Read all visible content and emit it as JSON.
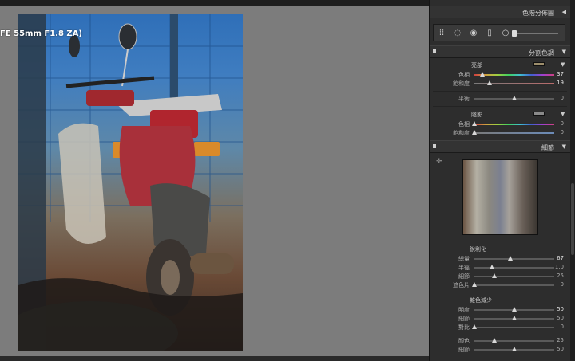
{
  "photo_overlay_text": "FE 55mm F1.8 ZA)",
  "histogram_panel": {
    "title": "色階分佈圖",
    "arrow": "◀"
  },
  "split_toning": {
    "title": "分割色調",
    "highlights": {
      "label": "亮部",
      "hue_label": "色相",
      "hue_value": "37",
      "sat_label": "飽和度",
      "sat_value": "19",
      "swatch_color": "#9d8e6c"
    },
    "balance": {
      "label": "平衡",
      "value": "0"
    },
    "shadows": {
      "label": "陰影",
      "hue_label": "色相",
      "hue_value": "0",
      "sat_label": "飽和度",
      "sat_value": "0",
      "swatch_color": "#8a8a8a"
    }
  },
  "detail": {
    "title": "細節",
    "sharpening": {
      "label": "銳利化",
      "rows": [
        {
          "label": "總量",
          "value": "67",
          "pos": 0.45,
          "hi": true
        },
        {
          "label": "半徑",
          "value": "1.0",
          "pos": 0.22,
          "hi": false
        },
        {
          "label": "細節",
          "value": "25",
          "pos": 0.25,
          "hi": false
        },
        {
          "label": "遮色片",
          "value": "0",
          "pos": 0.0,
          "hi": false
        }
      ]
    },
    "noise_reduction": {
      "label": "雜色減少",
      "rows": [
        {
          "label": "明度",
          "value": "50",
          "pos": 0.5,
          "hi": true
        },
        {
          "label": "細節",
          "value": "50",
          "pos": 0.5,
          "hi": false
        },
        {
          "label": "對比",
          "value": "0",
          "pos": 0.0,
          "hi": false
        },
        {
          "label": "顏色",
          "value": "25",
          "pos": 0.25,
          "hi": false
        },
        {
          "label": "細節",
          "value": "50",
          "pos": 0.5,
          "hi": false
        }
      ]
    }
  },
  "icons": {
    "collapse": "▼",
    "grid_tool": "grid-icon",
    "crop_tool": "crop-icon",
    "spot_tool": "spot-removal-icon"
  }
}
